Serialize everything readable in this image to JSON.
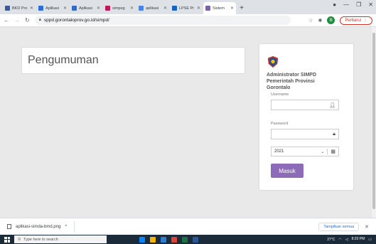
{
  "browser": {
    "tabs": [
      {
        "label": "BKD Pro",
        "color": "#3b5998",
        "active": false
      },
      {
        "label": "Aplikasi",
        "color": "#2d6bd6",
        "active": false
      },
      {
        "label": "Aplikasi",
        "color": "#2d6bd6",
        "active": false
      },
      {
        "label": "simpeg",
        "color": "#c2185b",
        "active": false
      },
      {
        "label": "aplikasi",
        "color": "#4285f4",
        "active": false
      },
      {
        "label": "LPSE Pr",
        "color": "#1565c0",
        "active": false
      },
      {
        "label": "Sistem",
        "color": "#7b61a8",
        "active": true
      }
    ],
    "url": "sppd.gorontaloprov.go.id/simpd/",
    "update_label": "Perbarui",
    "profile_initial": "B"
  },
  "page": {
    "announcement_title": "Pengumuman",
    "login": {
      "title_lines": [
        "Administrator SIMPD",
        "Pemerintah Provinsi",
        "Gorontalo"
      ],
      "username_label": "Username",
      "password_label": "Password",
      "year_value": "2021",
      "submit_label": "Masuk"
    }
  },
  "downloads": {
    "file_name": "aplikasi-simda-bmd.png",
    "show_all_label": "Tampilkan semua"
  },
  "taskbar": {
    "search_placeholder": "Type here to search",
    "weather": "27°C",
    "time": "8:20 PM"
  }
}
